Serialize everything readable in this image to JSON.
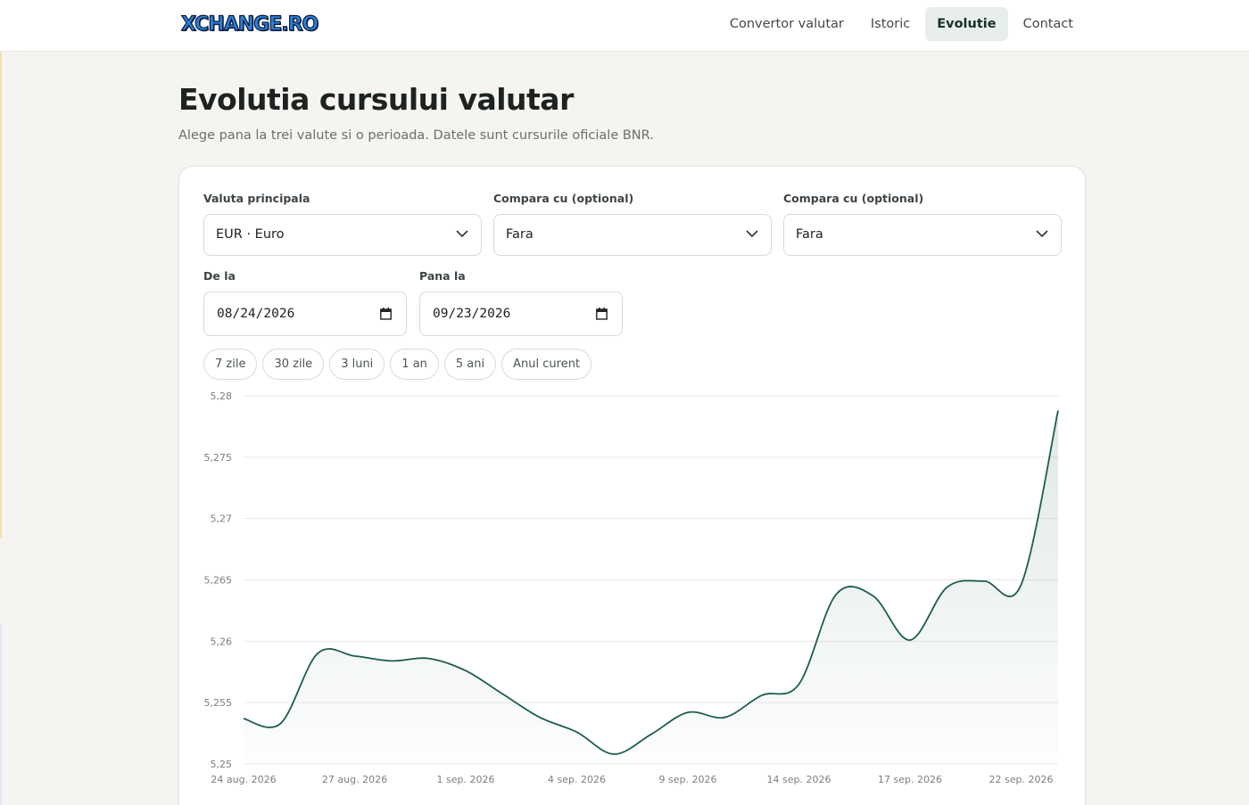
{
  "header": {
    "logo": "XCHANGE.RO",
    "nav": [
      "Convertor valutar",
      "Istoric",
      "Evolutie",
      "Contact"
    ],
    "active_nav": "Evolutie"
  },
  "page": {
    "title": "Evolutia cursului valutar",
    "subtitle": "Alege pana la trei valute si o perioada. Datele sunt cursurile oficiale BNR."
  },
  "form": {
    "main_currency": {
      "label": "Valuta principala",
      "value": "EUR · Euro"
    },
    "compare1": {
      "label": "Compara cu (optional)",
      "value": "Fara"
    },
    "compare2": {
      "label": "Compara cu (optional)",
      "value": "Fara"
    },
    "from": {
      "label": "De la",
      "value": "08/24/2026"
    },
    "to": {
      "label": "Pana la",
      "value": "09/23/2026"
    },
    "presets": [
      "7 zile",
      "30 zile",
      "3 luni",
      "1 an",
      "5 ani",
      "Anul curent"
    ]
  },
  "colors": {
    "accent": "#1d5e4c",
    "nav_active_bg": "#e8eeea",
    "page_bg": "#f5f4f0"
  },
  "chart_data": {
    "type": "area",
    "x_ticks": [
      "24 aug. 2026",
      "27 aug. 2026",
      "1 sep. 2026",
      "4 sep. 2026",
      "9 sep. 2026",
      "14 sep. 2026",
      "17 sep. 2026",
      "22 sep. 2026"
    ],
    "y_ticks": [
      "5,28",
      "5,275",
      "5,27",
      "5,265",
      "5,26",
      "5,255",
      "5,25"
    ],
    "ylim": [
      5.25,
      5.28
    ],
    "grid": true,
    "series": [
      {
        "values": [
          [
            "24 aug. 2026",
            5.2537
          ],
          [
            "25 aug. 2026",
            5.2533
          ],
          [
            "26 aug. 2026",
            5.259
          ],
          [
            "27 aug. 2026",
            5.2588
          ],
          [
            "28 aug. 2026",
            5.2584
          ],
          [
            "31 aug. 2026",
            5.2586
          ],
          [
            "1 sep. 2026",
            5.2576
          ],
          [
            "2 sep. 2026",
            5.2557
          ],
          [
            "3 sep. 2026",
            5.2538
          ],
          [
            "4 sep. 2026",
            5.2526
          ],
          [
            "7 sep. 2026",
            5.2508
          ],
          [
            "8 sep. 2026",
            5.2524
          ],
          [
            "9 sep. 2026",
            5.2542
          ],
          [
            "10 sep. 2026",
            5.2538
          ],
          [
            "11 sep. 2026",
            5.2556
          ],
          [
            "14 sep. 2026",
            5.2565
          ],
          [
            "15 sep. 2026",
            5.2638
          ],
          [
            "16 sep. 2026",
            5.2637
          ],
          [
            "17 sep. 2026",
            5.2601
          ],
          [
            "18 sep. 2026",
            5.2644
          ],
          [
            "21 sep. 2026",
            5.2649
          ],
          [
            "22 sep. 2026",
            5.2646
          ],
          [
            "23 sep. 2026",
            5.2788
          ]
        ]
      }
    ]
  }
}
